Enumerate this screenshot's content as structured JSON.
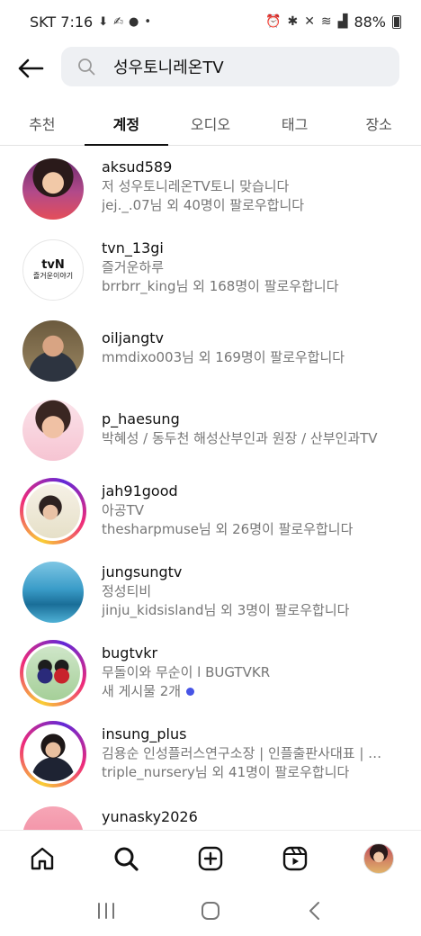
{
  "status_bar": {
    "carrier_time": "SKT 7:16",
    "battery": "88%"
  },
  "search": {
    "query": "성우토니레온TV"
  },
  "tabs": [
    {
      "label": "추천",
      "active": false
    },
    {
      "label": "계정",
      "active": true
    },
    {
      "label": "오디오",
      "active": false
    },
    {
      "label": "태그",
      "active": false
    },
    {
      "label": "장소",
      "active": false
    }
  ],
  "results": [
    {
      "username": "aksud589",
      "line1": "저 성우토니레온TV토니 맞습니다",
      "line2": "jej._.07님 외 40명이 팔로우합니다",
      "story_ring": false
    },
    {
      "username": "tvn_13gi",
      "line1": "즐거운하루",
      "line2": "brrbrr_king님 외 168명이 팔로우합니다",
      "story_ring": false,
      "avatar_text": "tvN",
      "avatar_subtext": "즐거운이야기"
    },
    {
      "username": "oiljangtv",
      "line1": "mmdixo003님 외 169명이 팔로우합니다",
      "story_ring": false
    },
    {
      "username": "p_haesung",
      "line1": "박혜성 / 동두천 해성산부인과 원장 / 산부인과TV",
      "story_ring": false
    },
    {
      "username": "jah91good",
      "line1": "아공TV",
      "line2": "thesharpmuse님 외 26명이 팔로우합니다",
      "story_ring": true
    },
    {
      "username": "jungsungtv",
      "line1": "정성티비",
      "line2": "jinju_kidsisland님 외 3명이 팔로우합니다",
      "story_ring": false
    },
    {
      "username": "bugtvkr",
      "line1": "무돌이와 무순이 l BUGTVKR",
      "line2": "새 게시물 2개",
      "story_ring": true,
      "new_posts_dot": true
    },
    {
      "username": "insung_plus",
      "line1": "김용순 인성플러스연구소장 | 인플출판사대표 | …",
      "line2": "triple_nursery님 외 41명이 팔로우합니다",
      "story_ring": true
    },
    {
      "username": "yunasky2026",
      "story_ring": false
    }
  ],
  "bottom_nav": [
    "home-icon",
    "search-icon",
    "create-icon",
    "reels-icon",
    "profile-avatar"
  ],
  "colors": {
    "accent_dot": "#4754e6",
    "secondary_text": "#767676",
    "search_bg": "#eef0f3"
  }
}
